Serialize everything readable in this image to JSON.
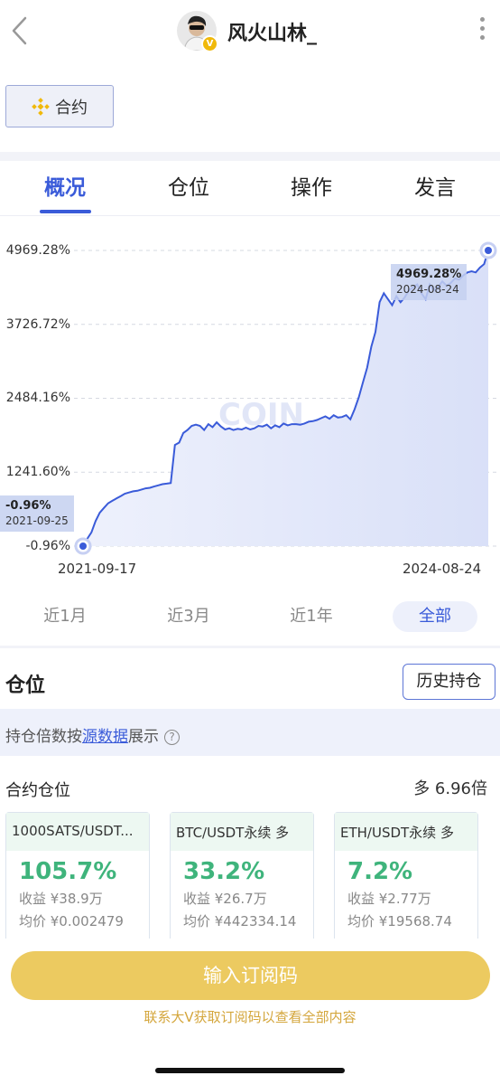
{
  "header": {
    "username": "风火山林_",
    "verified_badge": "V",
    "back_icon": "chevron-left-icon",
    "more_icon": "vertical-dots-icon"
  },
  "contract_button": {
    "label": "合约",
    "icon": "binance-logo-icon",
    "icon_color": "#f0b90b"
  },
  "tabs": [
    {
      "label": "概况",
      "active": true
    },
    {
      "label": "仓位",
      "active": false
    },
    {
      "label": "操作",
      "active": false
    },
    {
      "label": "发言",
      "active": false
    }
  ],
  "chart_data": {
    "type": "area",
    "y_ticks": [
      "4969.28%",
      "3726.72%",
      "2484.16%",
      "1241.60%",
      "-0.96%"
    ],
    "ylim": [
      -0.96,
      4969.28
    ],
    "x_ticks": [
      "2021-09-17",
      "2024-08-24"
    ],
    "watermark": "COIN",
    "accent_color": "#3a5bd9",
    "series": [
      {
        "values": [
          -0.96,
          120,
          230,
          420,
          560,
          640,
          720,
          760,
          800,
          840,
          880,
          900,
          920,
          930,
          950,
          970,
          980,
          1000,
          1020,
          1040,
          1050,
          1060,
          1700,
          1740,
          1900,
          1950,
          2020,
          2040,
          2020,
          1950,
          2050,
          2000,
          2080,
          2010,
          1960,
          1980,
          1950,
          1970,
          1960,
          1990,
          1960,
          1980,
          2020,
          2010,
          2040,
          1980,
          2030,
          2000,
          2060,
          2030,
          2050,
          2050,
          2040,
          2060,
          2090,
          2100,
          2120,
          2150,
          2180,
          2140,
          2200,
          2160,
          2170,
          2200,
          2130,
          2300,
          2500,
          2750,
          3000,
          3350,
          3600,
          4100,
          4250,
          4150,
          4050,
          4200,
          4100,
          4180,
          4300,
          4350,
          4400,
          4250,
          4150,
          4400,
          4300,
          4360,
          4450,
          4380,
          4420,
          4500,
          4480,
          4550,
          4600,
          4620,
          4600,
          4680,
          4740,
          4969.28
        ]
      }
    ],
    "start_label": {
      "value": "-0.96%",
      "date": "2021-09-25"
    },
    "end_label": {
      "value": "4969.28%",
      "date": "2024-08-24"
    }
  },
  "ranges": [
    {
      "label": "近1月",
      "active": false
    },
    {
      "label": "近3月",
      "active": false
    },
    {
      "label": "近1年",
      "active": false
    },
    {
      "label": "全部",
      "active": true
    }
  ],
  "positions": {
    "title": "仓位",
    "history_button": "历史持仓",
    "notice_prefix": "持仓倍数按",
    "notice_link": "源数据",
    "notice_suffix": "展示",
    "help_icon": "question-circle-icon",
    "contract_label": "合约仓位",
    "leverage": "多 6.96倍",
    "cards": [
      {
        "symbol": "1000SATS/USDT...",
        "pct": "105.7%",
        "profit": "收益 ¥38.9万",
        "avg_price": "均价 ¥0.002479"
      },
      {
        "symbol": "BTC/USDT永续 多",
        "pct": "33.2%",
        "profit": "收益 ¥26.7万",
        "avg_price": "均价 ¥442334.14"
      },
      {
        "symbol": "ETH/USDT永续 多",
        "pct": "7.2%",
        "profit": "收益 ¥2.77万",
        "avg_price": "均价 ¥19568.74"
      }
    ]
  },
  "footer": {
    "subscribe_button": "输入订阅码",
    "hint": "联系大V获取订阅码以查看全部内容"
  }
}
